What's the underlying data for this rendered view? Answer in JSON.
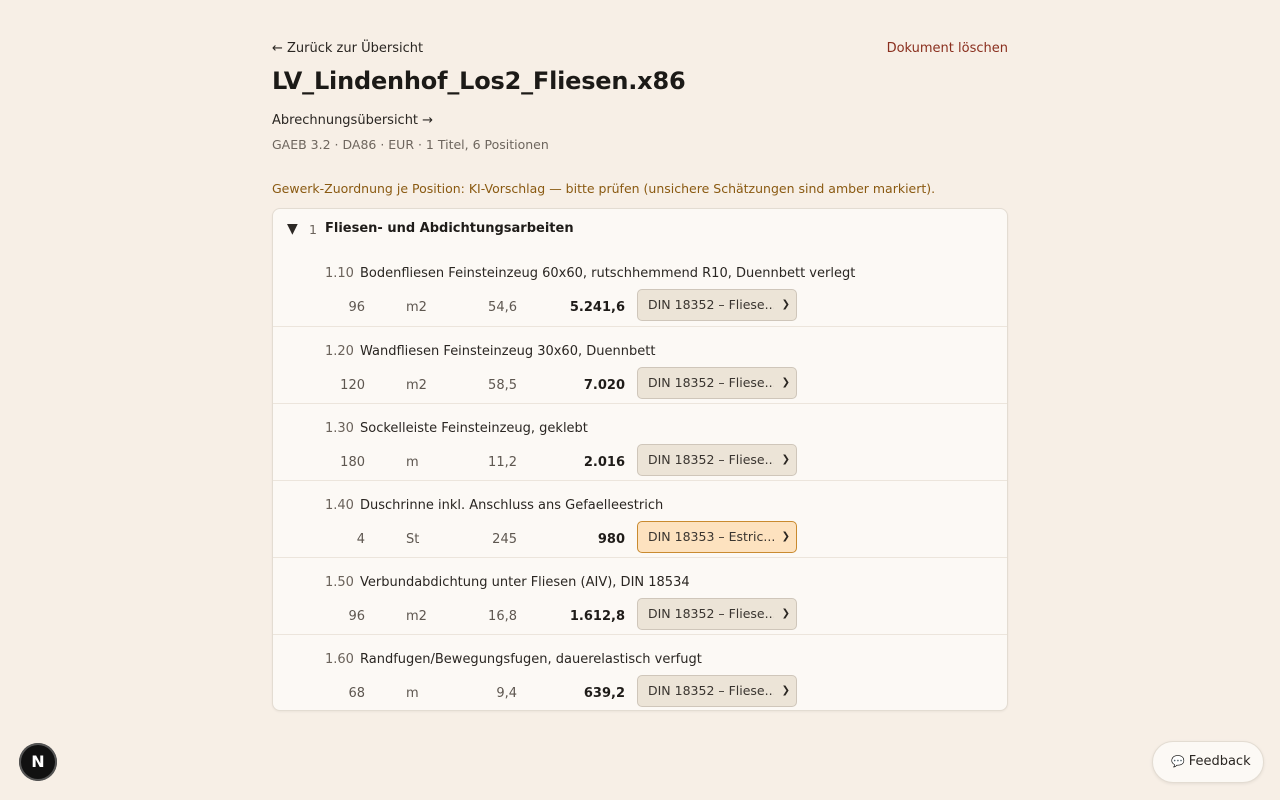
{
  "nav": {
    "back_label": "← Zurück zur Übersicht",
    "delete_label": "Dokument löschen"
  },
  "document": {
    "title": "LV_Lindenhof_Los2_Fliesen.x86",
    "abrechnung_link": "Abrechnungsübersicht →",
    "meta": "GAEB 3.2 · DA86 · EUR · 1 Titel, 6 Positionen",
    "notice": "Gewerk-Zuordnung je Position: KI-Vorschlag — bitte prüfen (unsichere Schätzungen sind amber markiert)."
  },
  "group": {
    "caret": "▼",
    "number": "1",
    "title": "Fliesen- und Abdichtungsarbeiten"
  },
  "positions": [
    {
      "num": "1.10",
      "text": "Bodenfliesen Feinsteinzeug 60x60, rutschhemmend R10, Duennbett verlegt",
      "qty": "96",
      "unit": "m2",
      "ep": "54,6",
      "gp": "5.241,6",
      "gewerk": "DIN 18352 – Fliese...",
      "unsure": false
    },
    {
      "num": "1.20",
      "text": "Wandfliesen Feinsteinzeug 30x60, Duennbett",
      "qty": "120",
      "unit": "m2",
      "ep": "58,5",
      "gp": "7.020",
      "gewerk": "DIN 18352 – Fliese...",
      "unsure": false
    },
    {
      "num": "1.30",
      "text": "Sockelleiste Feinsteinzeug, geklebt",
      "qty": "180",
      "unit": "m",
      "ep": "11,2",
      "gp": "2.016",
      "gewerk": "DIN 18352 – Fliese...",
      "unsure": false
    },
    {
      "num": "1.40",
      "text": "Duschrinne inkl. Anschluss ans Gefaelleestrich",
      "qty": "4",
      "unit": "St",
      "ep": "245",
      "gp": "980",
      "gewerk": "DIN 18353 – Estric...",
      "unsure": true
    },
    {
      "num": "1.50",
      "text": "Verbundabdichtung unter Fliesen (AIV), DIN 18534",
      "qty": "96",
      "unit": "m2",
      "ep": "16,8",
      "gp": "1.612,8",
      "gewerk": "DIN 18352 – Fliese...",
      "unsure": false
    },
    {
      "num": "1.60",
      "text": "Randfugen/Bewegungsfugen, dauerelastisch verfugt",
      "qty": "68",
      "unit": "m",
      "ep": "9,4",
      "gp": "639,2",
      "gewerk": "DIN 18352 – Fliese...",
      "unsure": false
    }
  ],
  "widgets": {
    "next_badge": "N",
    "feedback_icon": "💬",
    "feedback_label": "Feedback"
  }
}
